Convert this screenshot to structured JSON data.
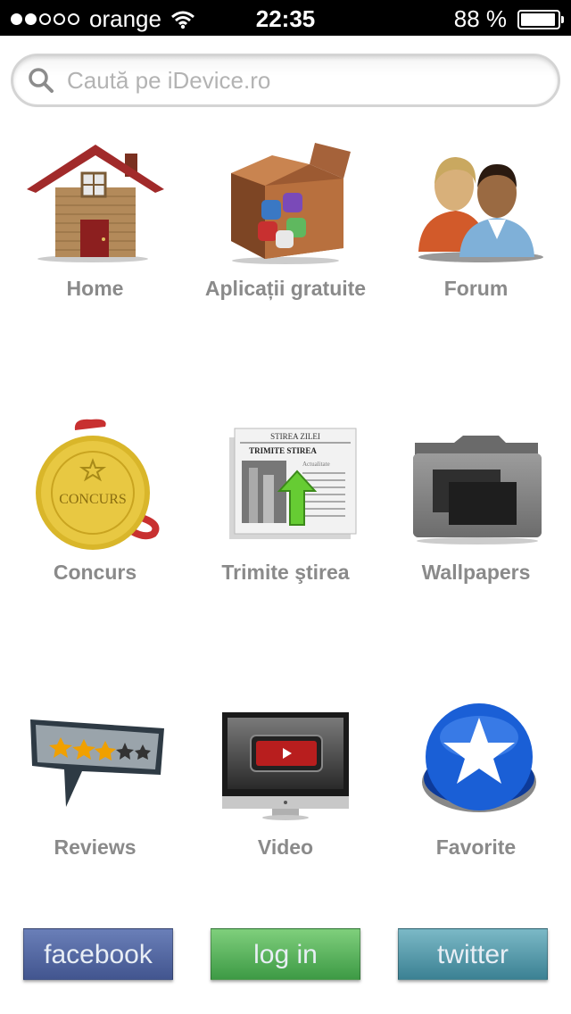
{
  "status_bar": {
    "carrier": "orange",
    "signal_bars_filled": 2,
    "signal_bars_total": 5,
    "time": "22:35",
    "battery_percent": "88 %",
    "battery_level": 0.88
  },
  "search": {
    "placeholder": "Caută pe iDevice.ro",
    "value": ""
  },
  "menu": {
    "items": [
      {
        "label": "Home",
        "icon": "house-icon"
      },
      {
        "label": "Aplicații gratuite",
        "icon": "app-box-icon"
      },
      {
        "label": "Forum",
        "icon": "users-icon"
      },
      {
        "label": "Concurs",
        "icon": "medal-icon"
      },
      {
        "label": "Trimite ştirea",
        "icon": "newspaper-icon"
      },
      {
        "label": "Wallpapers",
        "icon": "folder-icon"
      },
      {
        "label": "Reviews",
        "icon": "rating-stars-icon"
      },
      {
        "label": "Video",
        "icon": "monitor-video-icon"
      },
      {
        "label": "Favorite",
        "icon": "star-button-icon"
      }
    ]
  },
  "icon_text": {
    "medal": "CONCURS",
    "newspaper_header": "STIREA ZILEI",
    "newspaper_title": "TRIMITE STIREA",
    "newspaper_section": "Actualitate"
  },
  "social": {
    "facebook_label": "facebook",
    "login_label": "log in",
    "twitter_label": "twitter"
  },
  "colors": {
    "facebook": "#4f63a0",
    "login": "#4fad52",
    "twitter": "#4b92a3",
    "label_gray": "#8a8a8a"
  }
}
